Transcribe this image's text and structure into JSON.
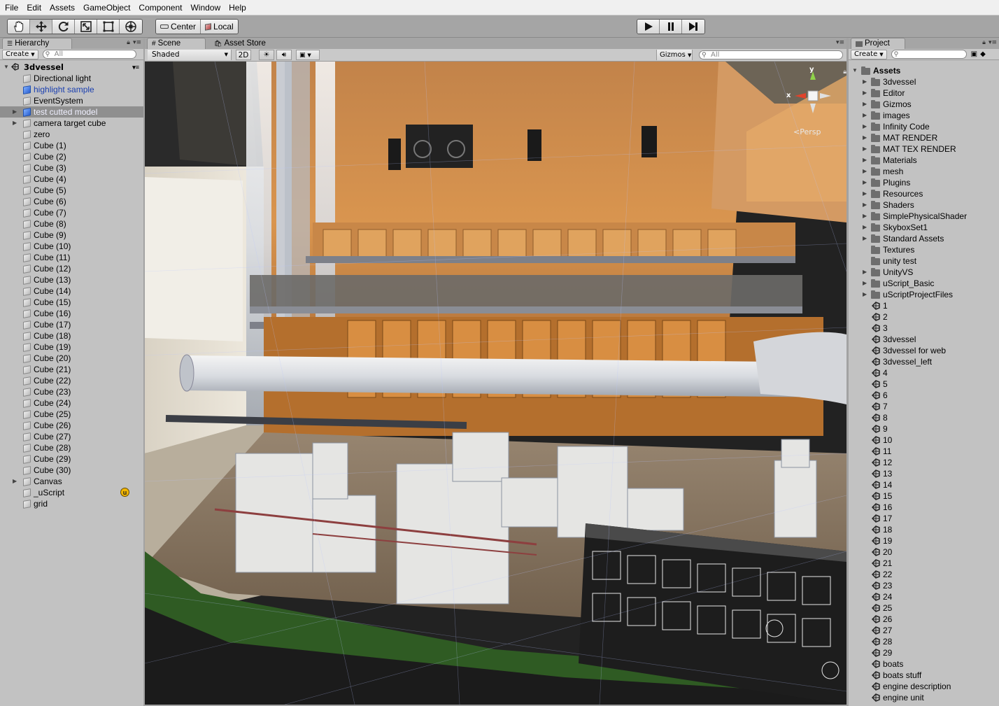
{
  "menu": [
    "File",
    "Edit",
    "Assets",
    "GameObject",
    "Component",
    "Window",
    "Help"
  ],
  "toolbar": {
    "tools": [
      "hand-icon",
      "move-icon",
      "rotate-icon",
      "scale-icon",
      "rect-icon",
      "transform-icon"
    ],
    "pivot_center": "Center",
    "pivot_local": "Local"
  },
  "hierarchy": {
    "tab": "Hierarchy",
    "create": "Create",
    "search_placeholder": "All",
    "scene_name": "3dvessel",
    "items": [
      {
        "label": "Directional light",
        "arrow": false,
        "style": "normal"
      },
      {
        "label": "highlight sample",
        "arrow": false,
        "style": "blue"
      },
      {
        "label": "EventSystem",
        "arrow": false,
        "style": "normal"
      },
      {
        "label": "test cutted model",
        "arrow": true,
        "style": "selected"
      },
      {
        "label": "camera target cube",
        "arrow": true,
        "style": "normal"
      },
      {
        "label": "zero",
        "arrow": false,
        "style": "normal"
      },
      {
        "label": "Cube (1)",
        "arrow": false,
        "style": "normal"
      },
      {
        "label": "Cube (2)",
        "arrow": false,
        "style": "normal"
      },
      {
        "label": "Cube (3)",
        "arrow": false,
        "style": "normal"
      },
      {
        "label": "Cube (4)",
        "arrow": false,
        "style": "normal"
      },
      {
        "label": "Cube (5)",
        "arrow": false,
        "style": "normal"
      },
      {
        "label": "Cube (6)",
        "arrow": false,
        "style": "normal"
      },
      {
        "label": "Cube (7)",
        "arrow": false,
        "style": "normal"
      },
      {
        "label": "Cube (8)",
        "arrow": false,
        "style": "normal"
      },
      {
        "label": "Cube (9)",
        "arrow": false,
        "style": "normal"
      },
      {
        "label": "Cube (10)",
        "arrow": false,
        "style": "normal"
      },
      {
        "label": "Cube (11)",
        "arrow": false,
        "style": "normal"
      },
      {
        "label": "Cube (12)",
        "arrow": false,
        "style": "normal"
      },
      {
        "label": "Cube (13)",
        "arrow": false,
        "style": "normal"
      },
      {
        "label": "Cube (14)",
        "arrow": false,
        "style": "normal"
      },
      {
        "label": "Cube (15)",
        "arrow": false,
        "style": "normal"
      },
      {
        "label": "Cube (16)",
        "arrow": false,
        "style": "normal"
      },
      {
        "label": "Cube (17)",
        "arrow": false,
        "style": "normal"
      },
      {
        "label": "Cube (18)",
        "arrow": false,
        "style": "normal"
      },
      {
        "label": "Cube (19)",
        "arrow": false,
        "style": "normal"
      },
      {
        "label": "Cube (20)",
        "arrow": false,
        "style": "normal"
      },
      {
        "label": "Cube (21)",
        "arrow": false,
        "style": "normal"
      },
      {
        "label": "Cube (22)",
        "arrow": false,
        "style": "normal"
      },
      {
        "label": "Cube (23)",
        "arrow": false,
        "style": "normal"
      },
      {
        "label": "Cube (24)",
        "arrow": false,
        "style": "normal"
      },
      {
        "label": "Cube (25)",
        "arrow": false,
        "style": "normal"
      },
      {
        "label": "Cube (26)",
        "arrow": false,
        "style": "normal"
      },
      {
        "label": "Cube (27)",
        "arrow": false,
        "style": "normal"
      },
      {
        "label": "Cube (28)",
        "arrow": false,
        "style": "normal"
      },
      {
        "label": "Cube (29)",
        "arrow": false,
        "style": "normal"
      },
      {
        "label": "Cube (30)",
        "arrow": false,
        "style": "normal"
      },
      {
        "label": "Canvas",
        "arrow": true,
        "style": "normal"
      },
      {
        "label": "_uScript",
        "arrow": false,
        "style": "normal",
        "badge": "u"
      },
      {
        "label": "grid",
        "arrow": false,
        "style": "normal"
      }
    ]
  },
  "scene": {
    "tab_scene": "Scene",
    "tab_store": "Asset Store",
    "shading": "Shaded",
    "mode_2d": "2D",
    "gizmos": "Gizmos",
    "search_placeholder": "All",
    "persp": "Persp",
    "axis_x": "x",
    "axis_y": "y"
  },
  "project": {
    "tab": "Project",
    "create": "Create",
    "root": "Assets",
    "folders": [
      {
        "label": "3dvessel",
        "arrow": true
      },
      {
        "label": "Editor",
        "arrow": true
      },
      {
        "label": "Gizmos",
        "arrow": true
      },
      {
        "label": "images",
        "arrow": true
      },
      {
        "label": "Infinity Code",
        "arrow": true
      },
      {
        "label": "MAT RENDER",
        "arrow": true
      },
      {
        "label": "MAT TEX RENDER",
        "arrow": true
      },
      {
        "label": "Materials",
        "arrow": true
      },
      {
        "label": "mesh",
        "arrow": true
      },
      {
        "label": "Plugins",
        "arrow": true
      },
      {
        "label": "Resources",
        "arrow": true
      },
      {
        "label": "Shaders",
        "arrow": true
      },
      {
        "label": "SimplePhysicalShader",
        "arrow": true
      },
      {
        "label": "SkyboxSet1",
        "arrow": true
      },
      {
        "label": "Standard Assets",
        "arrow": true
      },
      {
        "label": "Textures",
        "arrow": false
      },
      {
        "label": "unity test",
        "arrow": false
      },
      {
        "label": "UnityVS",
        "arrow": true
      },
      {
        "label": "uScript_Basic",
        "arrow": true
      },
      {
        "label": "uScriptProjectFiles",
        "arrow": true
      }
    ],
    "scenes": [
      "1",
      "2",
      "3",
      "3dvessel",
      "3dvessel for web",
      "3dvessel_left",
      "4",
      "5",
      "6",
      "7",
      "8",
      "9",
      "10",
      "11",
      "12",
      "13",
      "14",
      "15",
      "16",
      "17",
      "18",
      "19",
      "20",
      "21",
      "22",
      "23",
      "24",
      "25",
      "26",
      "27",
      "28",
      "29",
      "boats",
      "boats stuff",
      "engine description",
      "engine unit"
    ]
  }
}
